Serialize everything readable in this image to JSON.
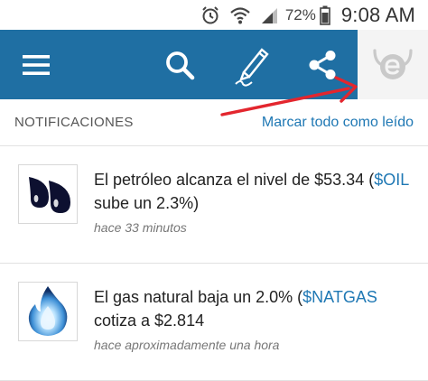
{
  "status_bar": {
    "battery_percent": "72%",
    "time": "9:08 AM",
    "icons": [
      "alarm-icon",
      "wifi-icon",
      "signal-icon",
      "battery-icon"
    ]
  },
  "app_bar": {
    "background": "#1f6fa3",
    "icons": [
      "menu-icon",
      "search-icon",
      "compose-icon",
      "share-icon",
      "profile-logo-icon"
    ]
  },
  "notifications": {
    "title": "NOTIFICACIONES",
    "mark_all_read": "Marcar todo como leído",
    "items": [
      {
        "text_before": "El petróleo alcanza el nivel de $53.34 (",
        "ticker": "$OIL",
        "text_after": " sube un 2.3%)",
        "time": "hace 33 minutos",
        "thumb_icon": "oil-drops-icon"
      },
      {
        "text_before": "El gas natural baja un 2.0% (",
        "ticker": "$NATGAS",
        "text_after": " cotiza a $2.814",
        "time": "hace aproximadamente una hora",
        "thumb_icon": "gas-flame-icon"
      }
    ]
  },
  "colors": {
    "accent": "#1f78b4",
    "annotation_arrow": "#e3262e"
  }
}
